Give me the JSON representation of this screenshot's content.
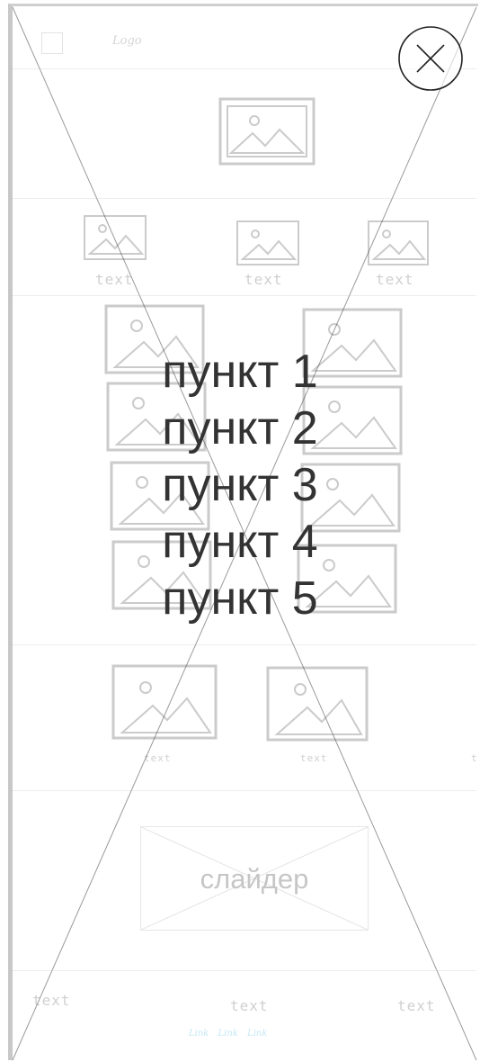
{
  "header": {
    "logo_text": "Logo"
  },
  "thumbs_row": {
    "labels": [
      "text",
      "text",
      "text"
    ]
  },
  "menu": {
    "items": [
      "пункт 1",
      "пункт 2",
      "пункт 3",
      "пункт 4",
      "пункт 5"
    ]
  },
  "lower_row": {
    "labels": [
      "text",
      "text",
      "t"
    ]
  },
  "slider": {
    "label": "слайдер"
  },
  "footer": {
    "texts": [
      "text",
      "text",
      "text"
    ],
    "links": [
      "Link",
      "Link",
      "Link"
    ]
  },
  "icons": {
    "close": "close-icon",
    "image": "image-placeholder-icon"
  }
}
